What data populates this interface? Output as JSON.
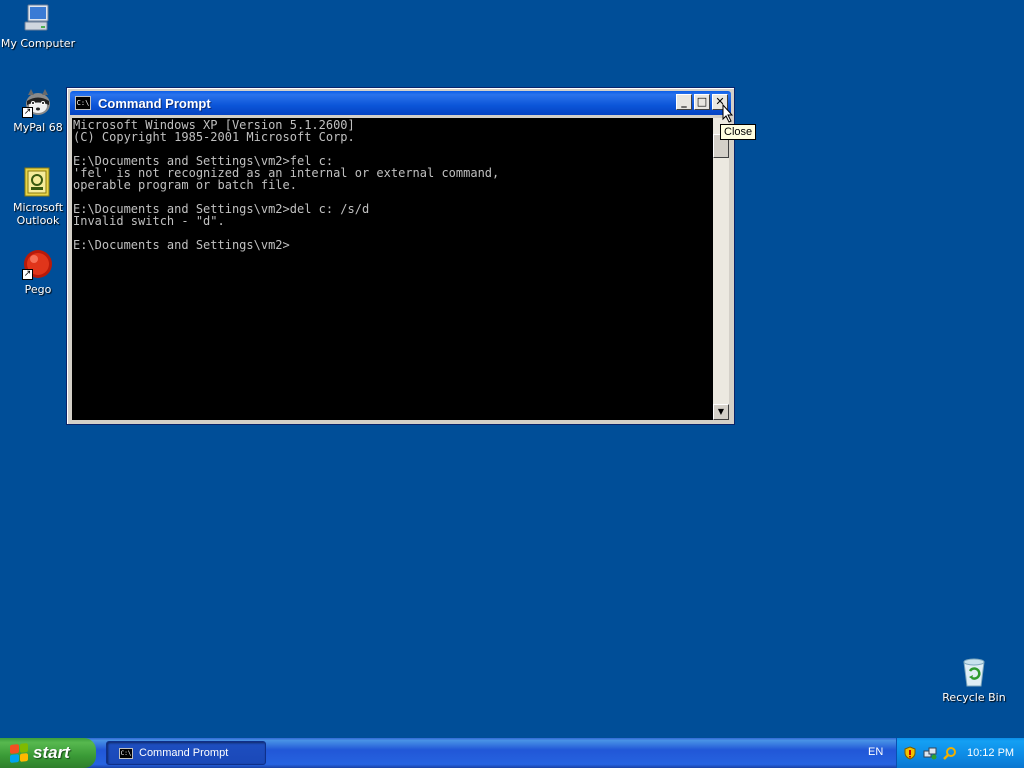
{
  "desktop": {
    "icons": [
      {
        "label": "My Computer"
      },
      {
        "label": "MyPal 68"
      },
      {
        "label": "Microsoft Outlook"
      },
      {
        "label": "Pego"
      },
      {
        "label": "Recycle Bin"
      }
    ]
  },
  "window": {
    "title": "Command Prompt",
    "icon_text": "C:\\",
    "buttons": {
      "minimize": "_",
      "maximize": "□",
      "close": "✕"
    },
    "console_lines": [
      "Microsoft Windows XP [Version 5.1.2600]",
      "(C) Copyright 1985-2001 Microsoft Corp.",
      "",
      "E:\\Documents and Settings\\vm2>fel c:",
      "'fel' is not recognized as an internal or external command,",
      "operable program or batch file.",
      "",
      "E:\\Documents and Settings\\vm2>del c: /s/d",
      "Invalid switch - \"d\".",
      "",
      "E:\\Documents and Settings\\vm2>"
    ]
  },
  "tooltip": {
    "text": "Close"
  },
  "taskbar": {
    "start_label": "start",
    "tasks": [
      {
        "label": "Command Prompt"
      }
    ],
    "language": "EN",
    "clock": "10:12 PM"
  },
  "colors": {
    "desktop": "#004e98",
    "titlebar": "#0b55d8",
    "console_bg": "#000000",
    "console_fg": "#c0c0c0",
    "start_green": "#3a9a36"
  }
}
